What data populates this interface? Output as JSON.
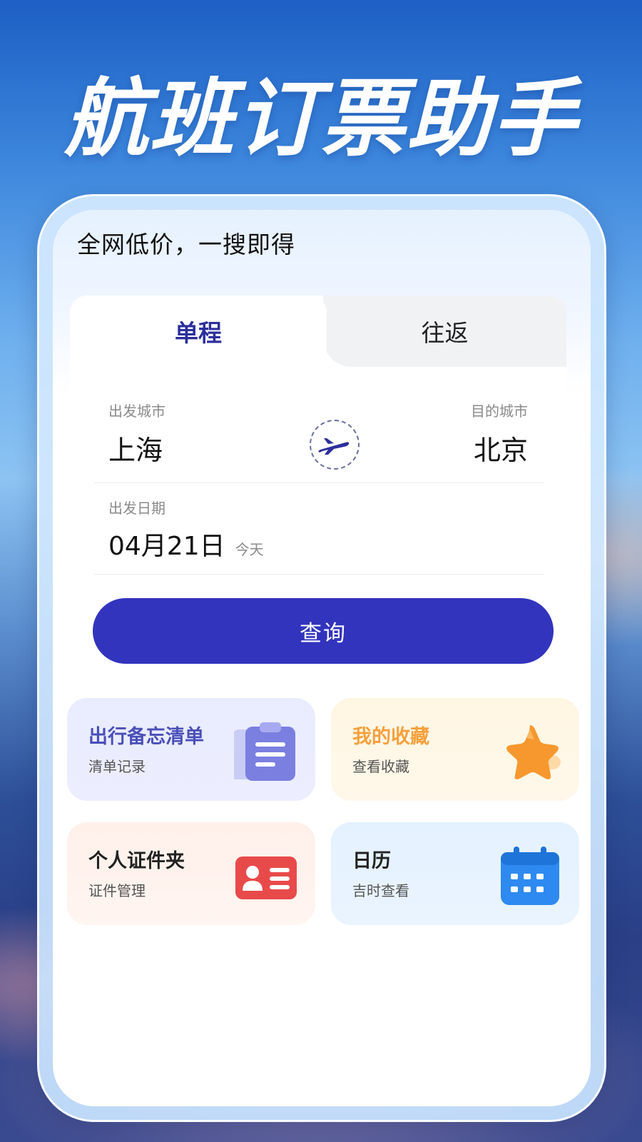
{
  "headline": "航班订票助手",
  "slogan": "全网低价，一搜即得",
  "tabs": {
    "oneway": "单程",
    "roundtrip": "往返"
  },
  "search": {
    "from_label": "出发城市",
    "from_city": "上海",
    "to_label": "目的城市",
    "to_city": "北京",
    "date_label": "出发日期",
    "date_value": "04月21日",
    "date_hint": "今天",
    "query_button": "查询",
    "swap_icon": "airplane-icon"
  },
  "tiles": [
    {
      "title": "出行备忘清单",
      "subtitle": "清单记录",
      "icon": "clipboard-icon",
      "color": "#4a4fb8"
    },
    {
      "title": "我的收藏",
      "subtitle": "查看收藏",
      "icon": "star-icon",
      "color": "#f5a03c"
    },
    {
      "title": "个人证件夹",
      "subtitle": "证件管理",
      "icon": "id-card-icon",
      "color": "#e84a4a"
    },
    {
      "title": "日历",
      "subtitle": "吉时查看",
      "icon": "calendar-icon",
      "color": "#2e8af0"
    }
  ],
  "colors": {
    "primary": "#3234bd",
    "sky": "#3c86dc"
  }
}
